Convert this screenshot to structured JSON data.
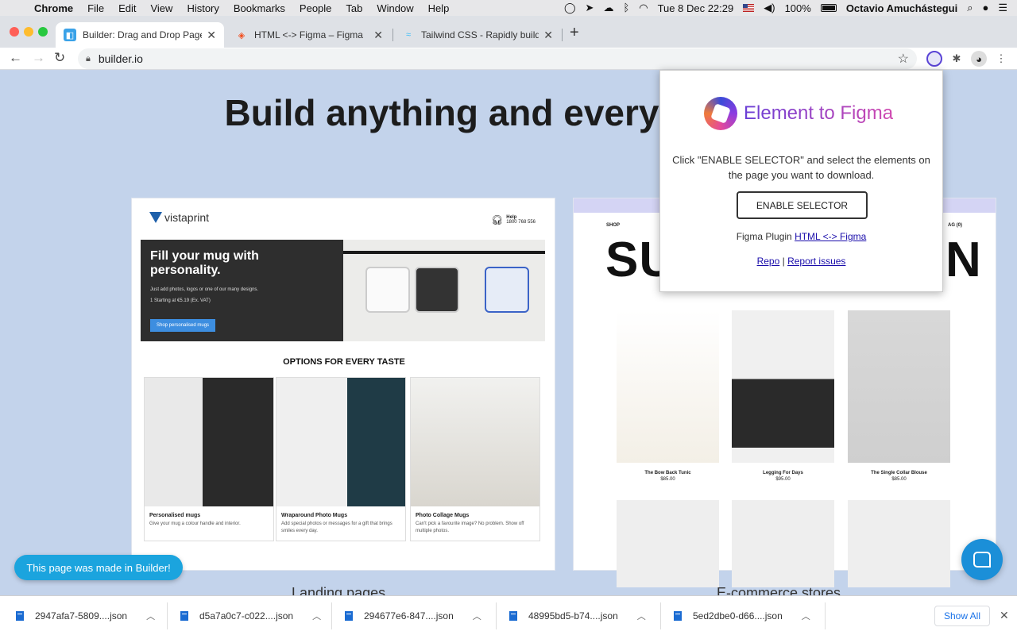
{
  "menubar": {
    "apple": "",
    "items": [
      "Chrome",
      "File",
      "Edit",
      "View",
      "History",
      "Bookmarks",
      "People",
      "Tab",
      "Window",
      "Help"
    ],
    "datetime": "Tue 8 Dec  22:29",
    "battery": "100%",
    "user": "Octavio Amuchástegui"
  },
  "tabs": [
    {
      "title": "Builder: Drag and Drop Page B",
      "favicon": "cube-icon",
      "active": true
    },
    {
      "title": "HTML <-> Figma – Figma",
      "favicon": "figma-icon",
      "active": false
    },
    {
      "title": "Tailwind CSS - Rapidly build m",
      "favicon": "tailwind-icon",
      "active": false
    }
  ],
  "toolbar": {
    "url": "builder.io"
  },
  "page": {
    "hero_title": "Build anything and every",
    "vistaprint": {
      "logo": "vistaprint",
      "help": "Help",
      "help_phone": "1800 768 556",
      "banner_title": "Fill your mug with personality.",
      "banner_sub": "Just add photos, logos or one of our many designs.",
      "banner_price": "1 Starting at €5.19 (Ex. VAT)",
      "banner_button": "Shop personalised mugs",
      "section_title": "OPTIONS FOR EVERY TASTE",
      "products": [
        {
          "title": "Personalised mugs",
          "desc": "Give your mug a colour handle and interior."
        },
        {
          "title": "Wraparound Photo Mugs",
          "desc": "Add special photos or messages for a gift that brings smiles every day."
        },
        {
          "title": "Photo Collage Mugs",
          "desc": "Can't pick a favourite image? No problem. Show off multiple photos."
        }
      ]
    },
    "ecommerce": {
      "shop": "SHOP",
      "bag": "AG (0)",
      "big_text_left": "SU",
      "big_text_right": "N",
      "items": [
        {
          "name": "The Bow Back Tunic",
          "price": "$85.00"
        },
        {
          "name": "Legging For Days",
          "price": "$95.00"
        },
        {
          "name": "The Single Collar Blouse",
          "price": "$85.00"
        }
      ]
    },
    "caption_left": "Landing pages",
    "caption_right": "E-commerce stores",
    "made_in_builder": "This page was made in Builder!"
  },
  "popup": {
    "brand": "Element to Figma",
    "instructions": "Click \"ENABLE SELECTOR\" and select the elements on the page you want to download.",
    "enable_button": "ENABLE SELECTOR",
    "plugin_prefix": "Figma Plugin",
    "plugin_link": "HTML <-> Figma",
    "repo_link": "Repo",
    "separator": "|",
    "issues_link": "Report issues"
  },
  "downloads": {
    "files": [
      "2947afa7-5809....json",
      "d5a7a0c7-c022....json",
      "294677e6-847....json",
      "48995bd5-b74....json",
      "5ed2dbe0-d66....json"
    ],
    "show_all": "Show All"
  },
  "colors": {
    "page_bg": "#c3d3eb",
    "builder_button": "#1ba4de",
    "chat_button": "#1b8fd8",
    "link": "#1a0dab",
    "show_all": "#1a73e8"
  }
}
